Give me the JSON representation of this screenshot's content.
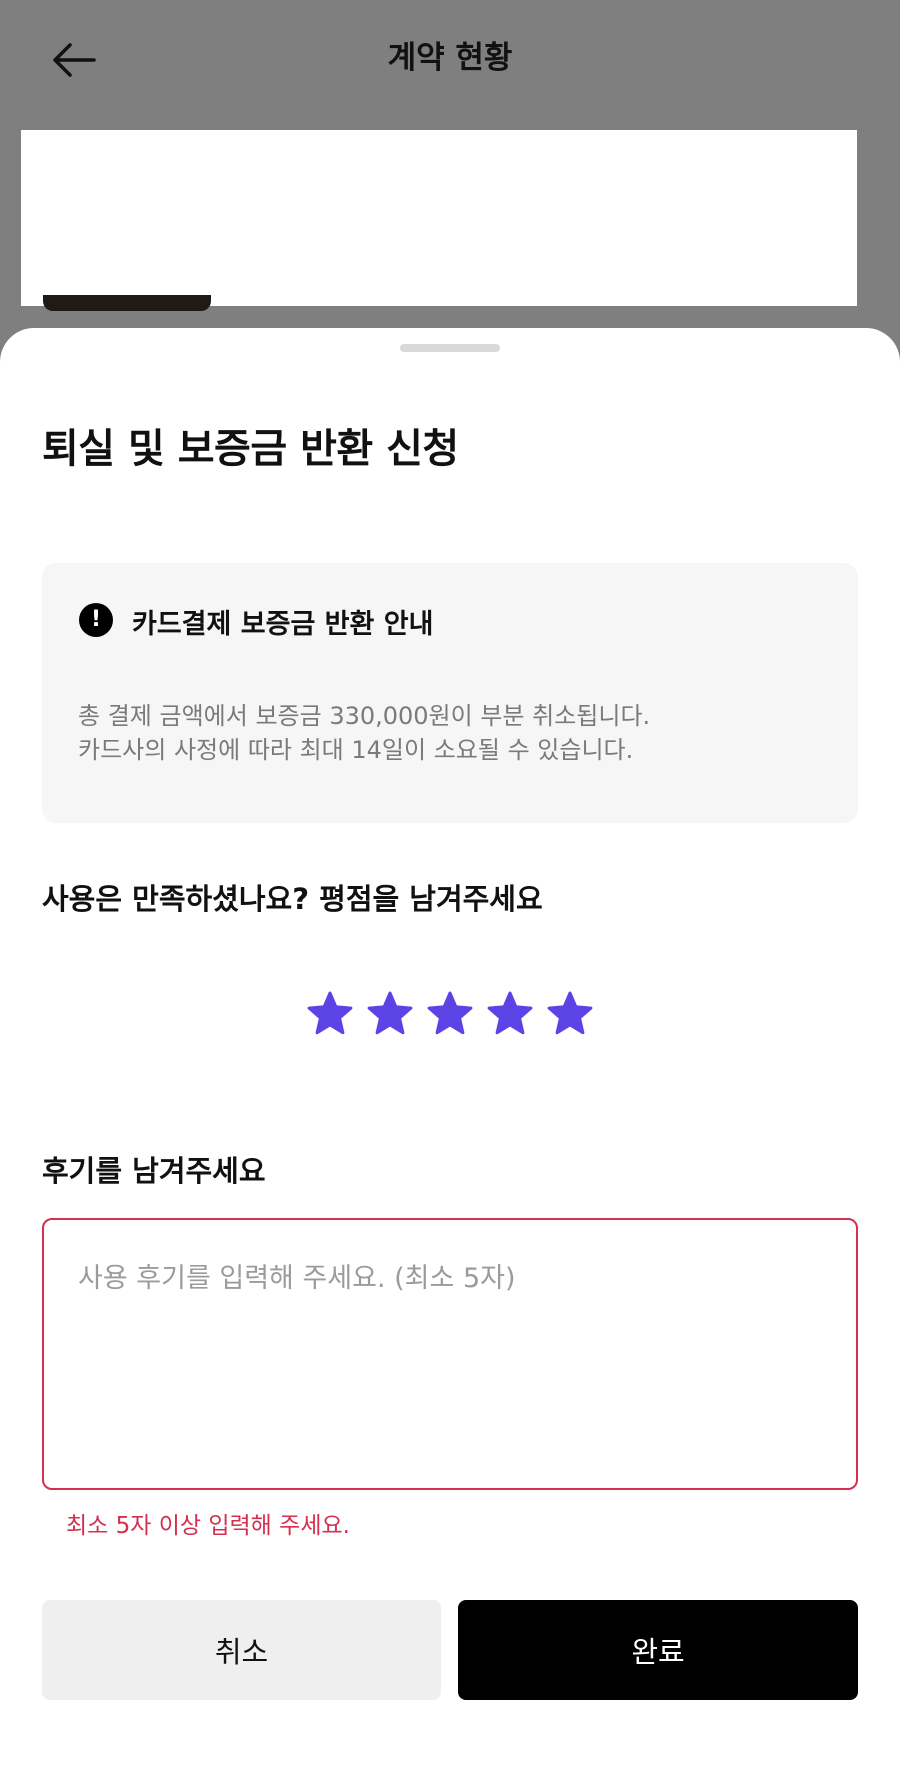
{
  "header": {
    "title": "계약 현황",
    "back_icon": "arrow-left-icon"
  },
  "sheet": {
    "title": "퇴실 및 보증금 반환 신청",
    "notice": {
      "icon": "exclamation-circle-icon",
      "title": "카드결제 보증금 반환 안내",
      "lines": [
        "총 결제 금액에서 보증금 330,000원이 부분 취소됩니다.",
        "카드사의 사정에 따라 최대 14일이 소요될 수 있습니다."
      ]
    },
    "rating": {
      "label": "사용은 만족하셨나요? 평점을 남겨주세요",
      "value": 5,
      "max": 5,
      "star_color": "#5b43e6"
    },
    "review": {
      "label": "후기를 남겨주세요",
      "value": "",
      "placeholder": "사용 후기를 입력해 주세요. (최소 5자)",
      "error": "최소 5자 이상 입력해 주세요.",
      "error_color": "#d4304f"
    },
    "buttons": {
      "cancel": "취소",
      "done": "완료"
    }
  }
}
